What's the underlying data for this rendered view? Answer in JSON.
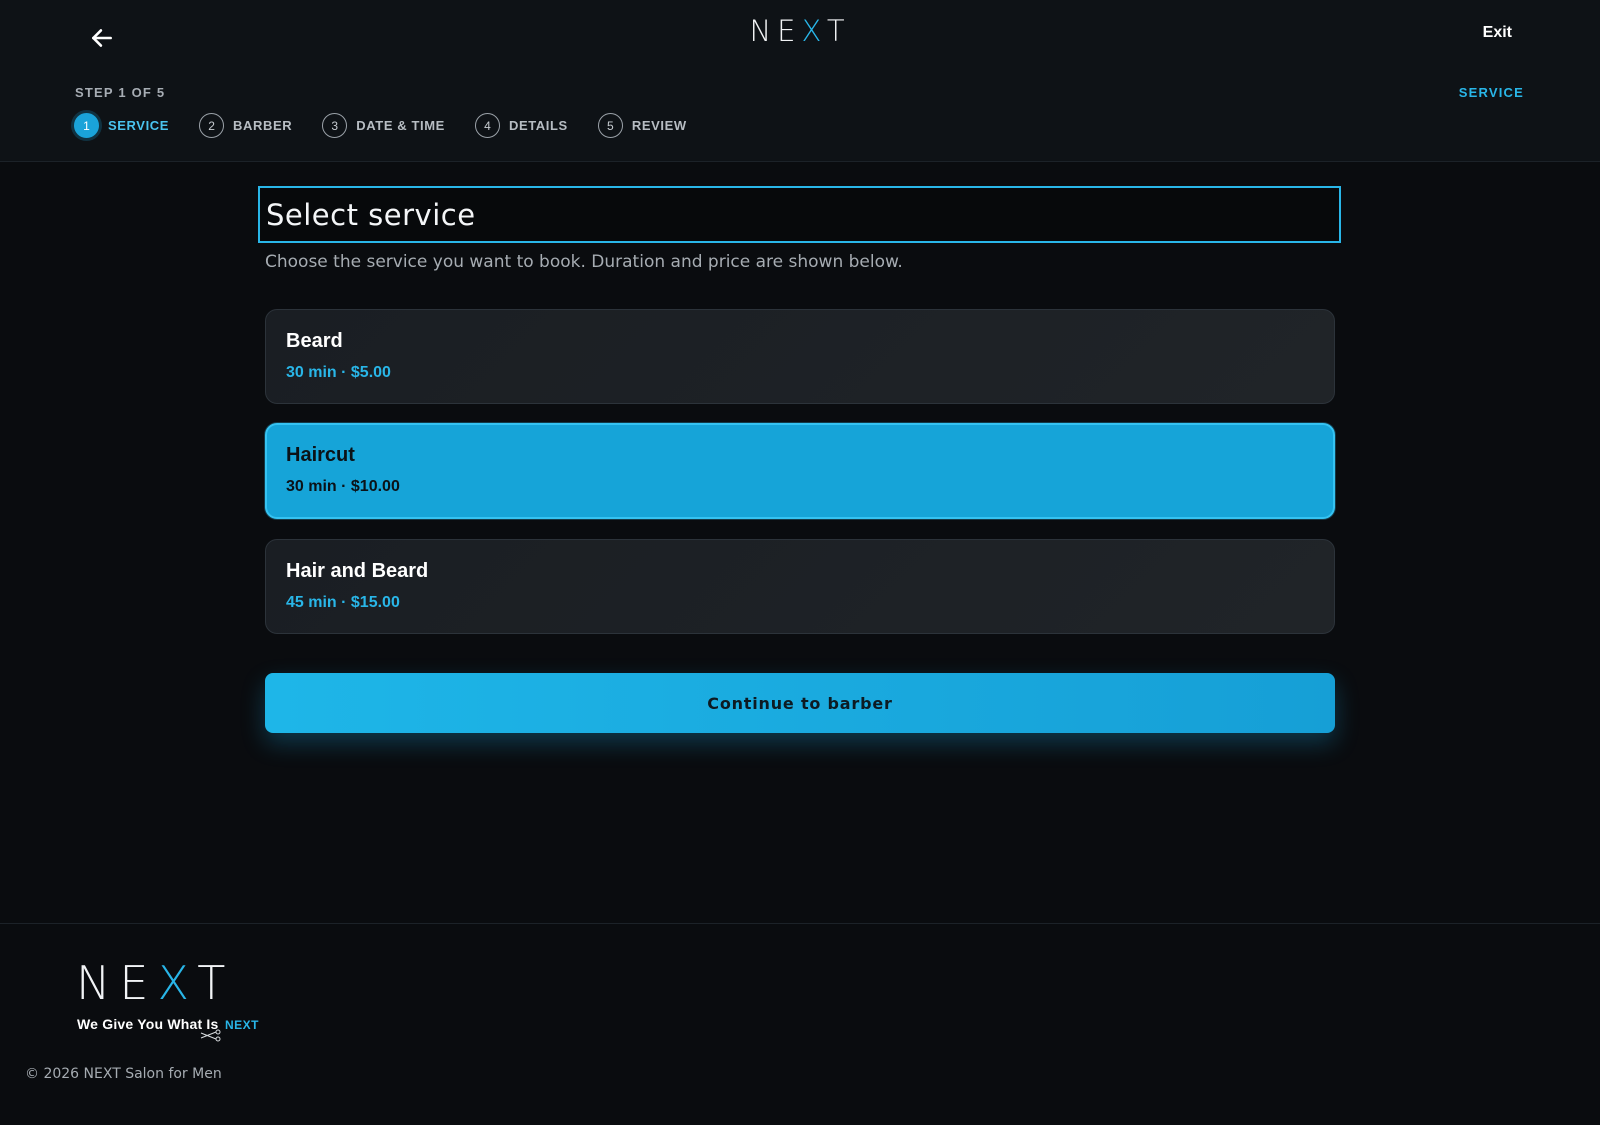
{
  "header": {
    "logo": {
      "pre": "NE",
      "accent": "X",
      "post": "T"
    },
    "exit_label": "Exit",
    "step_count": "STEP 1 OF 5",
    "current_step_label": "SERVICE",
    "steps": [
      {
        "number": "1",
        "label": "SERVICE",
        "active": true
      },
      {
        "number": "2",
        "label": "BARBER",
        "active": false
      },
      {
        "number": "3",
        "label": "DATE & TIME",
        "active": false
      },
      {
        "number": "4",
        "label": "DETAILS",
        "active": false
      },
      {
        "number": "5",
        "label": "REVIEW",
        "active": false
      }
    ]
  },
  "main": {
    "title": "Select service",
    "subtitle": "Choose the service you want to book. Duration and price are shown below.",
    "services": [
      {
        "name": "Beard",
        "meta": "30 min · $5.00",
        "selected": false
      },
      {
        "name": "Haircut",
        "meta": "30 min · $10.00",
        "selected": true
      },
      {
        "name": "Hair and Beard",
        "meta": "45 min · $15.00",
        "selected": false
      }
    ],
    "continue_label": "Continue to barber"
  },
  "footer": {
    "logo": {
      "pre": "NE",
      "accent": "X",
      "post": "T"
    },
    "tagline": "We Give You What Is",
    "tagline_brand": "NEXT",
    "copyright": "© 2026 NEXT Salon for Men"
  },
  "colors": {
    "accent": "#29b6e8",
    "selected_card": "#16a4d8",
    "background": "#0a0c0f",
    "card": "#1d2125"
  },
  "icons": {
    "back": "arrow-left-icon",
    "scissors": "scissors-icon"
  }
}
